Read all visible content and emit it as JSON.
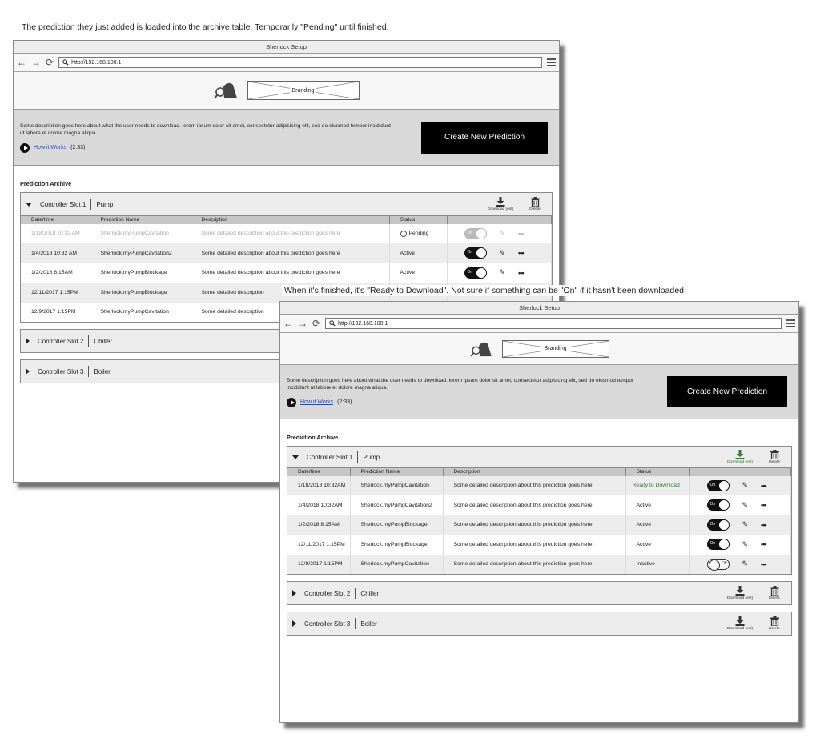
{
  "notes": {
    "top": "The prediction they just added is loaded into the archive table. Temporarily \"Pending\" until finished.",
    "bottom": "When it's finished, it's \"Ready to Download\". Not sure if something can be \"On\" if it hasn't been downloaded"
  },
  "browser": {
    "title": "Sherlock Setup",
    "url": "http://192.168.100.1",
    "back_icon": "arrow-left-icon",
    "forward_icon": "arrow-right-icon",
    "reload_icon": "reload-icon",
    "menu_icon": "hamburger-menu-icon"
  },
  "branding": {
    "logo_icon": "sherlock-magnifier-logo",
    "label": "Branding"
  },
  "info": {
    "description": "Some description goes here about what the user needs to download. lorem ipsum dolor sit amet, consectetur adipisicing elit, sed do eiusmod tempor incididunt ut labore et dolore magna aliqua.",
    "how_label": "How it Works",
    "how_duration": "(2:33)",
    "cta": "Create New Prediction"
  },
  "archive": {
    "title": "Prediction Archive",
    "columns": [
      "Date/time",
      "Prediction Name",
      "Description",
      "Status"
    ],
    "download_label": "Download (est)",
    "delete_label": "Delete",
    "colors": {
      "ready": "#2e7d32",
      "download_active": "#2e7d32"
    }
  },
  "screen1": {
    "slots": [
      {
        "name": "Controller Slot 1",
        "device": "Pump"
      },
      {
        "name": "Controller Slot 2",
        "device": "Chiller"
      },
      {
        "name": "Controller Slot 3",
        "device": "Boiler"
      }
    ],
    "rows": [
      {
        "date": "1/18/2018 10:32 AM",
        "name": "Sherlock.myPumpCavitation",
        "desc": "Some detailed description about this prediction goes here",
        "status": "Pending",
        "toggle": "On"
      },
      {
        "date": "1/4/2018 10:32 AM",
        "name": "Sherlock.myPumpCavitation2",
        "desc": "Some detailed description about this prediction goes here",
        "status": "Active",
        "toggle": "On"
      },
      {
        "date": "1/2/2018 8:15AM",
        "name": "Sherlock.myPumpBlockage",
        "desc": "Some detailed description about this prediction goes here",
        "status": "Active",
        "toggle": "On"
      },
      {
        "date": "12/11/2017 1:15PM",
        "name": "Sherlock.myPumpBlockage",
        "desc": "Some detailed description",
        "status": "",
        "toggle": ""
      },
      {
        "date": "12/9/2017 1:15PM",
        "name": "Sherlock.myPumpCavitation",
        "desc": "Some detailed description",
        "status": "",
        "toggle": ""
      }
    ]
  },
  "screen2": {
    "slots": [
      {
        "name": "Controller Slot 1",
        "device": "Pump"
      },
      {
        "name": "Controller Slot 2",
        "device": "Chiller"
      },
      {
        "name": "Controller Slot 3",
        "device": "Boiler"
      }
    ],
    "rows": [
      {
        "date": "1/18/2018 10:32AM",
        "name": "Sherlock.myPumpCavitation",
        "desc": "Some detailed description about this prediction goes here",
        "status": "Ready to Download",
        "toggle": "On"
      },
      {
        "date": "1/4/2018 10:32AM",
        "name": "Sherlock.myPumpCavitation2",
        "desc": "Some detailed description about this prediction goes here",
        "status": "Active",
        "toggle": "On"
      },
      {
        "date": "1/2/2018 8:15AM",
        "name": "Sherlock.myPumpBlockage",
        "desc": "Some detailed description about this prediction goes here",
        "status": "Active",
        "toggle": "On"
      },
      {
        "date": "12/11/2017 1:15PM",
        "name": "Sherlock.myPumpBlockage",
        "desc": "Some detailed description about this prediction goes here",
        "status": "Active",
        "toggle": "On"
      },
      {
        "date": "12/9/2017 1:15PM",
        "name": "Sherlock.myPumpCavitation",
        "desc": "Some detailed description about this prediction goes here",
        "status": "Inactive",
        "toggle": "Off"
      }
    ]
  }
}
